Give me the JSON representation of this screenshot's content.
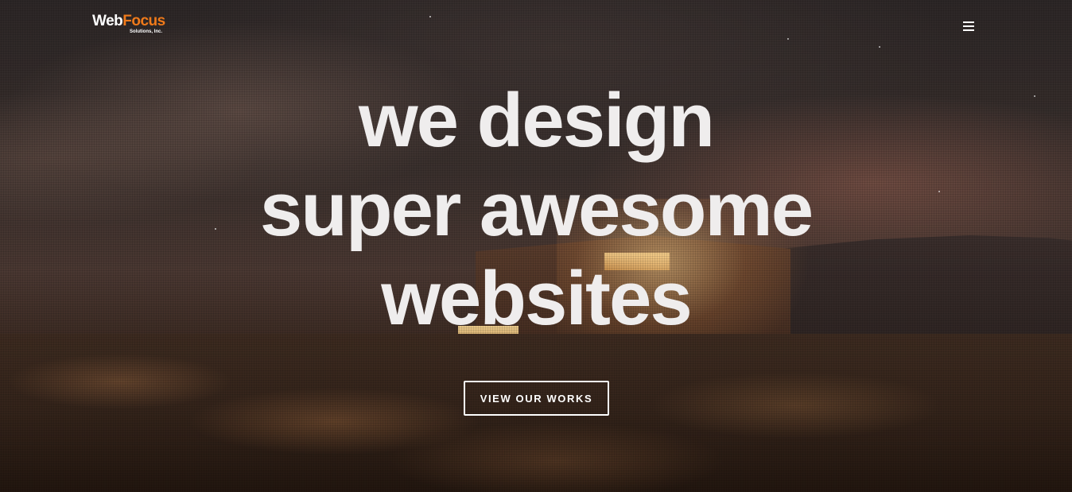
{
  "header": {
    "logo": {
      "word_web": "Web",
      "word_focus": "Focus",
      "subtitle": "Solutions, Inc.",
      "colors": {
        "web": "#ffffff",
        "focus": "#f07a1a"
      }
    },
    "menu_icon": "hamburger-menu-icon"
  },
  "hero": {
    "headline_lines": [
      "we design",
      "super awesome",
      "websites"
    ],
    "cta_label": "VIEW OUR WORKS",
    "text_color": "#efeded"
  }
}
